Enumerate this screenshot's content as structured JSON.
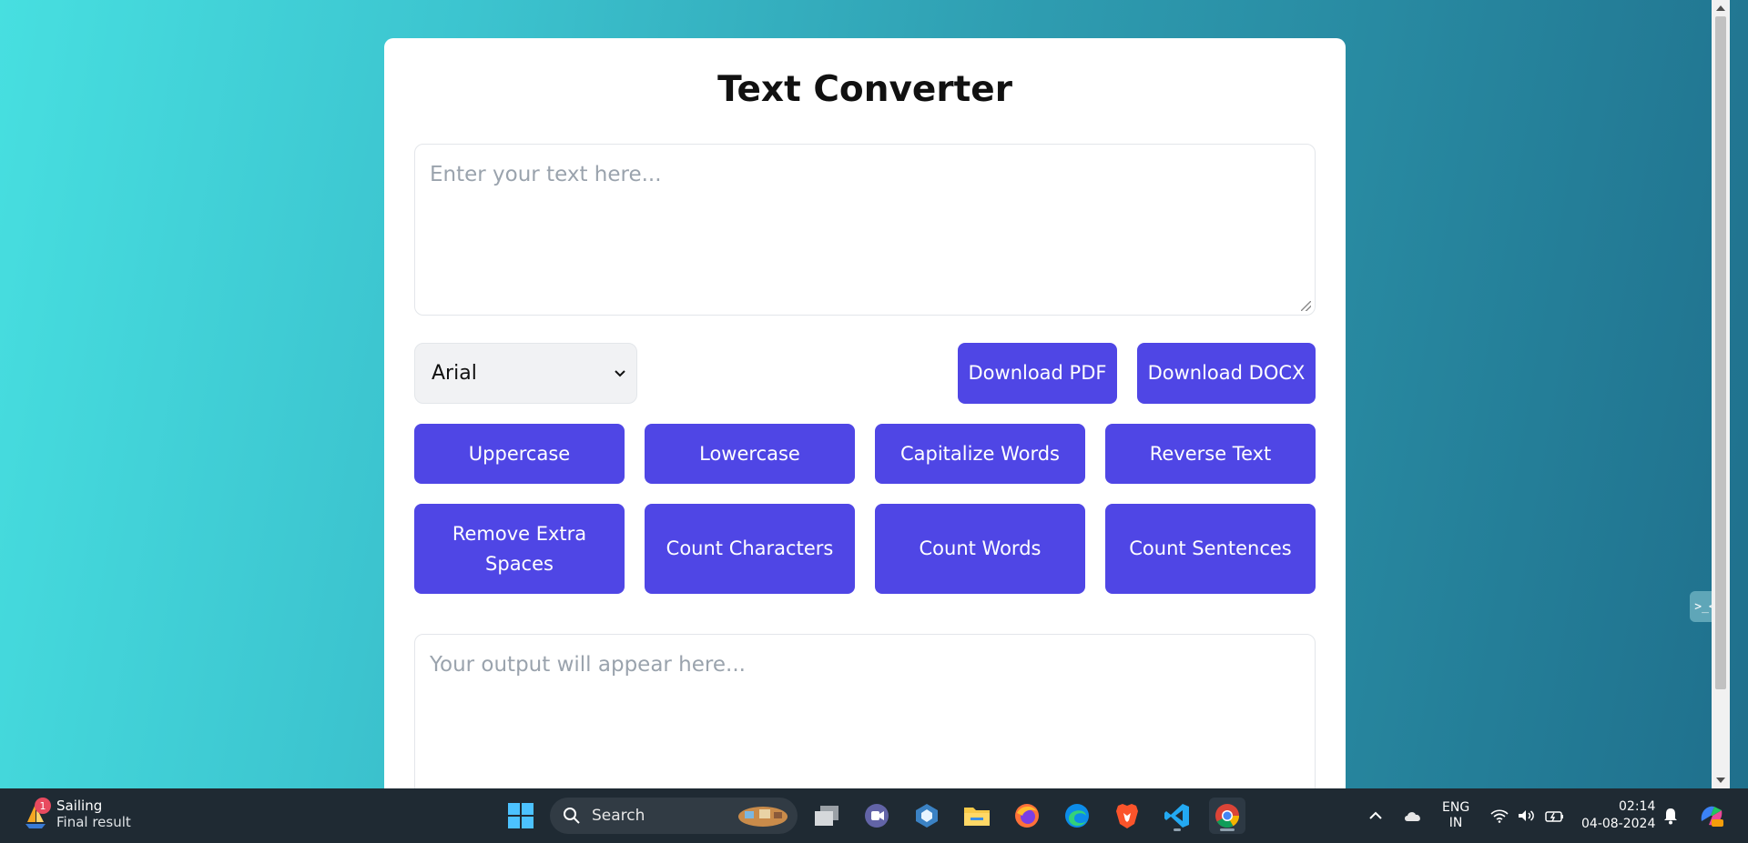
{
  "app": {
    "title": "Text Converter",
    "input_placeholder": "Enter your text here...",
    "output_placeholder": "Your output will appear here...",
    "font_select": {
      "selected": "Arial",
      "options": [
        "Arial"
      ]
    },
    "download_pdf_label": "Download PDF",
    "download_docx_label": "Download DOCX",
    "buttons": {
      "uppercase": "Uppercase",
      "lowercase": "Lowercase",
      "capitalize": "Capitalize Words",
      "reverse": "Reverse Text",
      "remove_spaces": "Remove Extra Spaces",
      "count_characters": "Count Characters",
      "count_words": "Count Words",
      "count_sentences": "Count Sentences"
    },
    "accent_color": "#4f46e5"
  },
  "taskbar": {
    "weather": {
      "title": "Sailing",
      "subtitle": "Final result",
      "badge": "1"
    },
    "search_label": "Search",
    "language": {
      "line1": "ENG",
      "line2": "IN"
    },
    "clock": {
      "time": "02:14",
      "date": "04-08-2024"
    },
    "pinned_icons": [
      "windows-start-icon",
      "search-icon",
      "task-view-icon",
      "teams-icon",
      "copilot-icon",
      "file-explorer-icon",
      "firefox-icon",
      "edge-icon",
      "brave-icon",
      "vscode-icon",
      "chrome-icon"
    ],
    "tray_icons": [
      "chevron-up-icon",
      "onedrive-icon",
      "wifi-icon",
      "volume-icon",
      "battery-icon",
      "bell-icon",
      "copilot-pre-icon"
    ]
  }
}
